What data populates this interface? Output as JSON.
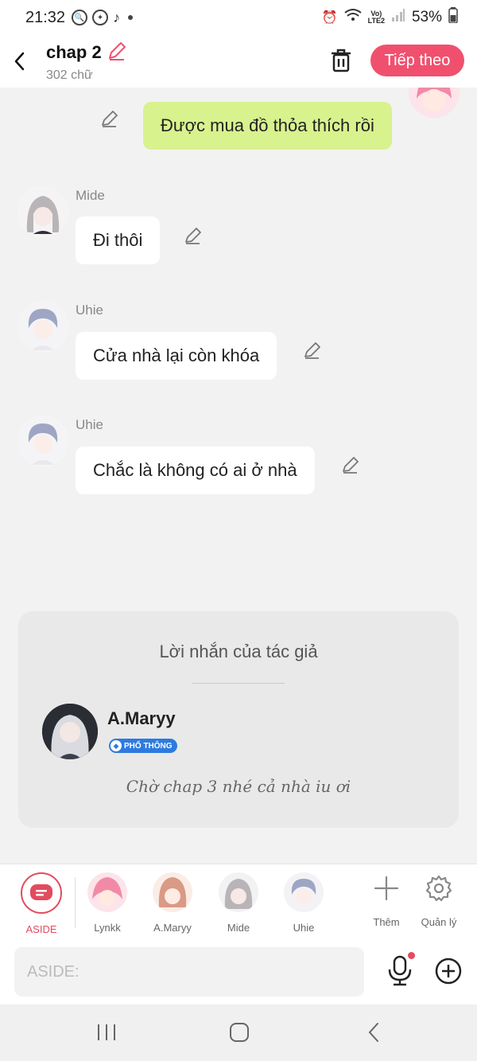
{
  "status_bar": {
    "time": "21:32",
    "battery": "53%",
    "network_top": "Vo)",
    "network_bottom": "LTE2"
  },
  "header": {
    "title": "chap 2",
    "word_count": "302 chữ",
    "next_label": "Tiếp theo"
  },
  "messages": [
    {
      "sender": "",
      "text": "Được mua đồ thỏa thích rồi",
      "side": "right"
    },
    {
      "sender": "Mide",
      "text": "Đi thôi",
      "side": "left"
    },
    {
      "sender": "Uhie",
      "text": "Cửa nhà lại còn khóa",
      "side": "left"
    },
    {
      "sender": "Uhie",
      "text": "Chắc là không có ai ở nhà",
      "side": "left"
    }
  ],
  "author_note": {
    "title": "Lời nhắn của tác giả",
    "author": "A.Maryy",
    "badge": "PHỔ THÔNG",
    "message": "Chờ chap 3 nhé cả nhà iu ơi"
  },
  "character_bar": {
    "aside_label": "ASIDE",
    "characters": [
      "Lynkk",
      "A.Maryy",
      "Mide",
      "Uhie"
    ],
    "add_label": "Thêm",
    "manage_label": "Quản lý"
  },
  "input": {
    "placeholder": "ASIDE:"
  },
  "colors": {
    "accent": "#f0506e",
    "green_bubble": "#d8f28e",
    "aside_red": "#e34b5f",
    "badge_blue": "#2d7be0"
  }
}
